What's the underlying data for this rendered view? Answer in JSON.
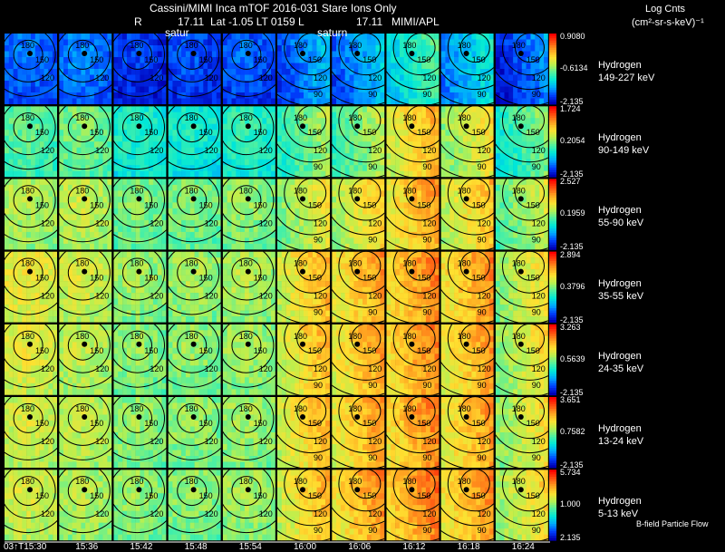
{
  "header": {
    "title": "Cassini/MIMI Inca mTOF  2016-031   Stare   Ions Only",
    "r_label": "R",
    "r_value": "17.11",
    "coords": "Lat -1.05 LT 0159 L",
    "l_value": "17.11",
    "org": "MIMI/APL",
    "saturn_a": "satur",
    "saturn_b": "saturn"
  },
  "units": {
    "line1": "Log Cnts",
    "line2": "(cm²-sr-s-keV)⁻¹"
  },
  "footer": {
    "flow_label": "B-field Particle Flow"
  },
  "colors": {
    "background": "#000000",
    "colormap": [
      "#0000b4",
      "#0040ff",
      "#00a8ff",
      "#00e8d8",
      "#50f0a0",
      "#b8f050",
      "#ffe030",
      "#ffa020",
      "#ff5010",
      "#ff0000"
    ]
  },
  "chart_data": {
    "type": "heatmap",
    "title": "Cassini/MIMI Inca mTOF  2016-031   Stare   Ions Only",
    "x_label": "",
    "x_ticks": [
      "03↑T15:30",
      "15:36",
      "15:42",
      "15:48",
      "15:54",
      "16:00",
      "16:06",
      "16:12",
      "16:18",
      "16:24"
    ],
    "contour_labels": [
      "180",
      "150",
      "120",
      "90"
    ],
    "rows": [
      {
        "name": "Hydrogen",
        "range": "149-227 keV",
        "cb_max": "0.9080",
        "cb_mid": "-0.6134",
        "cb_min": "-2.135",
        "levels": [
          0.12,
          0.14,
          0.06,
          0.08,
          0.1,
          0.18,
          0.2,
          0.36,
          0.26,
          0.12
        ]
      },
      {
        "name": "Hydrogen",
        "range": "90-149 keV",
        "cb_max": "1.724",
        "cb_mid": "0.2054",
        "cb_min": "-2.135",
        "levels": [
          0.42,
          0.45,
          0.34,
          0.33,
          0.36,
          0.46,
          0.48,
          0.66,
          0.58,
          0.42
        ]
      },
      {
        "name": "Hydrogen",
        "range": "55-90 keV",
        "cb_max": "2.527",
        "cb_mid": "0.1959",
        "cb_min": "-2.135",
        "levels": [
          0.52,
          0.54,
          0.46,
          0.46,
          0.48,
          0.56,
          0.62,
          0.7,
          0.64,
          0.52
        ]
      },
      {
        "name": "Hydrogen",
        "range": "35-55 keV",
        "cb_max": "2.894",
        "cb_mid": "0.3796",
        "cb_min": "-2.135",
        "levels": [
          0.6,
          0.56,
          0.5,
          0.5,
          0.52,
          0.66,
          0.7,
          0.74,
          0.72,
          0.58
        ]
      },
      {
        "name": "Hydrogen",
        "range": "24-35 keV",
        "cb_max": "3.263",
        "cb_mid": "0.5639",
        "cb_min": "-2.135",
        "levels": [
          0.58,
          0.54,
          0.48,
          0.48,
          0.5,
          0.66,
          0.7,
          0.74,
          0.7,
          0.58
        ]
      },
      {
        "name": "Hydrogen",
        "range": "13-24 keV",
        "cb_max": "3.651",
        "cb_mid": "0.7582",
        "cb_min": "-2.135",
        "levels": [
          0.56,
          0.54,
          0.48,
          0.48,
          0.5,
          0.66,
          0.7,
          0.74,
          0.7,
          0.58
        ]
      },
      {
        "name": "Hydrogen",
        "range": "5-13 keV",
        "cb_max": "5.734",
        "cb_mid": "1.000",
        "cb_min": "2.135",
        "levels": [
          0.56,
          0.52,
          0.48,
          0.48,
          0.5,
          0.66,
          0.72,
          0.76,
          0.72,
          0.6
        ]
      }
    ]
  }
}
